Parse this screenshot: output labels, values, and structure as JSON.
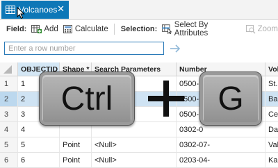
{
  "tab": {
    "title": "Volcanoes",
    "close": "✕",
    "icon": "table-icon"
  },
  "toolbar": {
    "field_label": "Field:",
    "add_label": "Add",
    "calculate_label": "Calculate",
    "selection_label": "Selection:",
    "select_by_attributes_label": "Select By Attributes",
    "zoom_label": "Zoom"
  },
  "goto": {
    "placeholder": "Enter a row number"
  },
  "grid": {
    "columns": [
      "OBJECTID *",
      "Shape *",
      "Search Parameters",
      "Number",
      "Vol"
    ],
    "rows": [
      {
        "n": "1",
        "objectid": "1",
        "shape": "",
        "search": "",
        "number": "0500-",
        "vol": "St."
      },
      {
        "n": "2",
        "objectid": "2",
        "shape": "",
        "search": "",
        "number": "0500-",
        "vol": "Bal"
      },
      {
        "n": "3",
        "objectid": "3",
        "shape": "",
        "search": "",
        "number": "0500-",
        "vol": "Cer"
      },
      {
        "n": "4",
        "objectid": "4",
        "shape": "",
        "search": "",
        "number": "0302-0",
        "vol": "Dac"
      },
      {
        "n": "5",
        "objectid": "5",
        "shape": "Point",
        "search": "<Null>",
        "number": "0302-07-",
        "vol": "Vak"
      },
      {
        "n": "6",
        "objectid": "6",
        "shape": "Point",
        "search": "<Null>",
        "number": "0203-04-",
        "vol": "Kar"
      }
    ],
    "selected_row": 2
  },
  "overlay": {
    "ctrl_key": "Ctrl",
    "g_key": "G"
  },
  "colors": {
    "accent": "#0d77b7",
    "selection": "#cfe3f3"
  }
}
